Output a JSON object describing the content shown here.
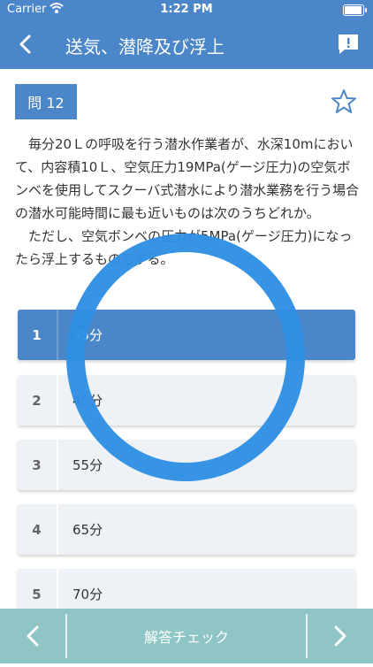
{
  "status_bar": {
    "carrier": "Carrier",
    "time": "1:22 PM"
  },
  "nav": {
    "title": "送気、潜降及び浮上"
  },
  "question": {
    "number_label": "問 12",
    "paragraphs": [
      "毎分20Ｌの呼吸を行う潜水作業者が、水深10mにおいて、内容積10Ｌ、空気圧力19MPa(ゲージ圧力)の空気ボンベを使用してスクーバ式潜水により潜水業務を行う場合の潜水可能時間に最も近いものは次のうちどれか。",
      "ただし、空気ボンベの圧力が5MPa(ゲージ圧力)になったら浮上するものとする。"
    ]
  },
  "choices": [
    {
      "number": "1",
      "text": "35分",
      "selected": true
    },
    {
      "number": "2",
      "text": "45分",
      "selected": false
    },
    {
      "number": "3",
      "text": "55分",
      "selected": false
    },
    {
      "number": "4",
      "text": "65分",
      "selected": false
    },
    {
      "number": "5",
      "text": "70分",
      "selected": false
    }
  ],
  "bottom_bar": {
    "check_label": "解答チェック"
  },
  "colors": {
    "primary": "#4a86c8",
    "toolbar": "#8fc5c5",
    "ring": "#2f8fe3",
    "choice_bg": "#eef2f7"
  }
}
